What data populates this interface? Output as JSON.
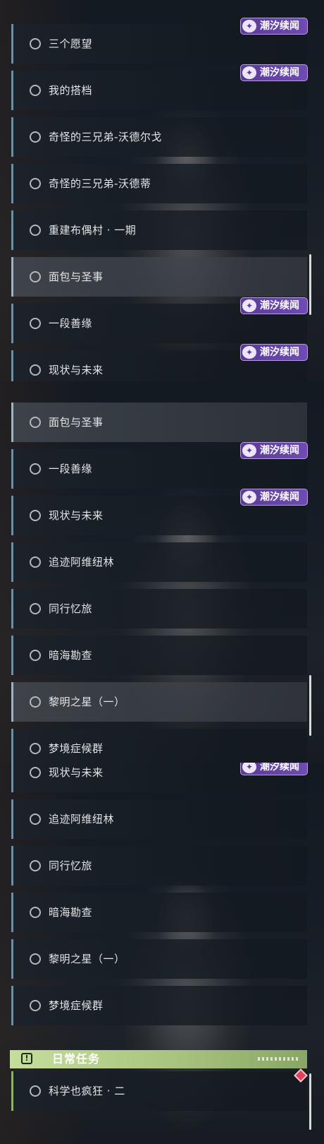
{
  "badge_label": "潮汐续闻",
  "badge_icon": "swallow-bird-icon",
  "section_daily": {
    "title": "日常任务",
    "icon": "exclamation-box-icon"
  },
  "panel1": [
    "三个愿望",
    "我的搭档",
    "奇怪的三兄弟-沃德尔戈",
    "奇怪的三兄弟-沃德蒂",
    "重建布偶村 · 一期",
    "面包与圣事",
    "一段善缘",
    "现状与未来"
  ],
  "panel2": [
    "面包与圣事",
    "一段善缘",
    "现状与未来",
    "追迹阿维纽林",
    "同行忆旅",
    "暗海勘查",
    "黎明之星（一）",
    "梦境症候群"
  ],
  "panel3": [
    "现状与未来",
    "追迹阿维纽林",
    "同行忆旅",
    "暗海勘查",
    "黎明之星（一）",
    "梦境症候群"
  ],
  "daily_quest": "科学也疯狂 · 二",
  "colors": {
    "badge": "#6e4cb3",
    "daily_header": "#b6d08c",
    "row_accent": "#6f8ea0",
    "marker": "#e0415a"
  }
}
